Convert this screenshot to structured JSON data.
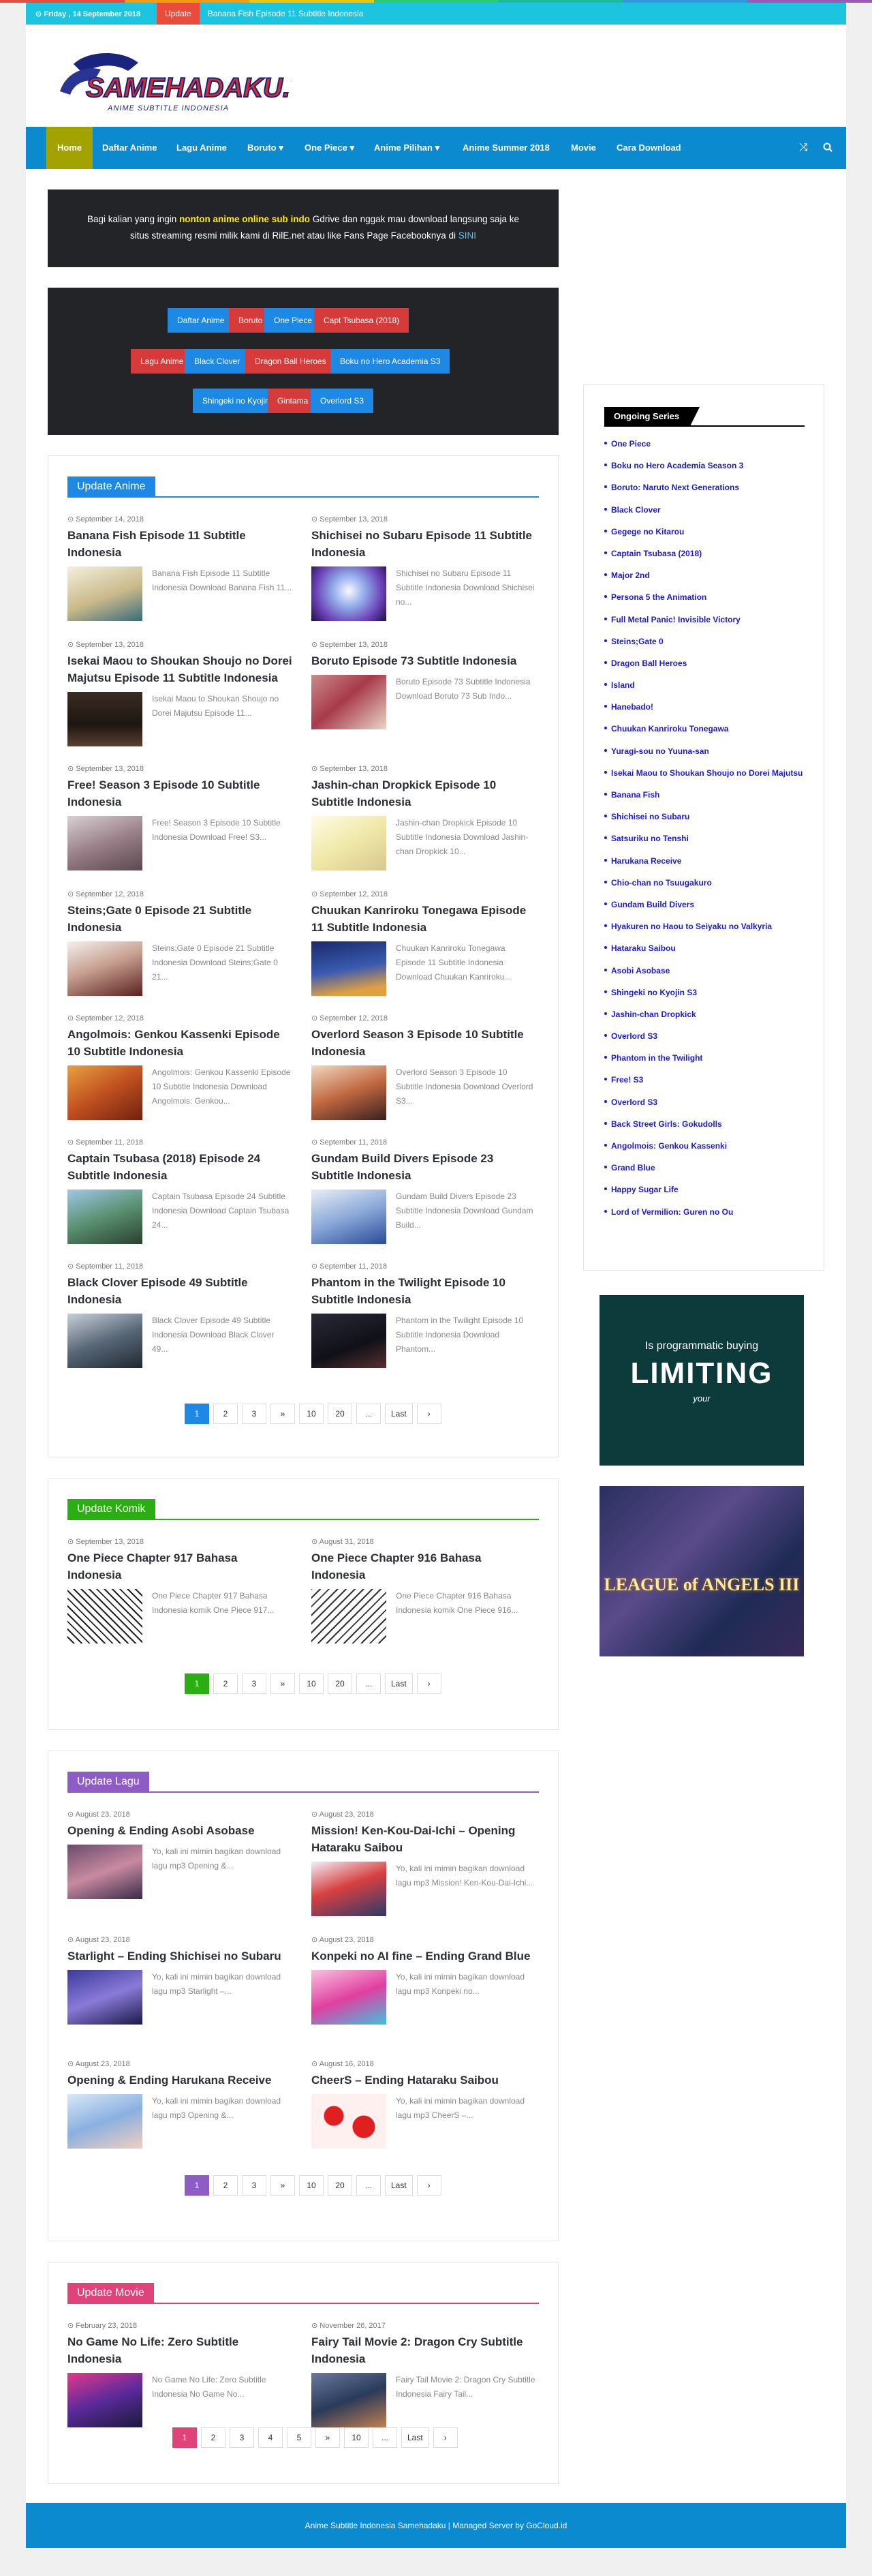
{
  "topbar": {
    "date": "Friday , 14 September 2018",
    "update_label": "Update",
    "ticker": "Banana Fish Episode 11 Subtitle Indonesia"
  },
  "logo": {
    "text": "SAMEHADAKU.TV",
    "sub": "ANIME SUBTITLE INDONESIA"
  },
  "nav": {
    "home": "Home",
    "items": [
      "Daftar Anime",
      "Lagu Anime",
      "Boruto",
      "One Piece",
      "Anime Pilihan",
      "Anime Summer 2018",
      "Movie",
      "Cara Download"
    ]
  },
  "notice": {
    "line1_pre": "Bagi kalian yang ingin ",
    "line1_bold": "nonton anime online sub indo",
    "line1_post": " Gdrive dan nggak mau download langsung saja ke",
    "line2_pre": "situs streaming resmi milik kami di RilE.net atau like Fans Page Facebooknya di ",
    "line2_link": "SINI"
  },
  "tags": [
    "Daftar Anime",
    "Boruto",
    "One Piece",
    "Capt Tsubasa (2018)",
    "Lagu Anime",
    "Black Clover",
    "Dragon Ball Heroes",
    "Boku no Hero Academia S3",
    "Shingeki no Kyojin S3",
    "Gintama",
    "Overlord S3"
  ],
  "update_anime": {
    "title": "Update Anime",
    "posts": [
      {
        "date": "September 14, 2018",
        "title": "Banana Fish Episode 11 Subtitle Indonesia",
        "excerpt": "Banana Fish Episode 11 Subtitle Indonesia Download Banana Fish 11..."
      },
      {
        "date": "September 13, 2018",
        "title": "Shichisei no Subaru Episode 11 Subtitle Indonesia",
        "excerpt": "Shichisei no Subaru Episode 11 Subtitle Indonesia Download Shichisei no..."
      },
      {
        "date": "September 13, 2018",
        "title": "Isekai Maou to Shoukan Shoujo no Dorei Majutsu Episode 11 Subtitle Indonesia",
        "excerpt": "Isekai Maou to Shoukan Shoujo no Dorei Majutsu Episode 11..."
      },
      {
        "date": "September 13, 2018",
        "title": "Boruto Episode 73 Subtitle Indonesia",
        "excerpt": "Boruto Episode 73 Subtitle Indonesia Download Boruto 73 Sub Indo..."
      },
      {
        "date": "September 13, 2018",
        "title": "Free! Season 3 Episode 10 Subtitle Indonesia",
        "excerpt": "Free! Season 3 Episode 10 Subtitle Indonesia Download Free! S3..."
      },
      {
        "date": "September 13, 2018",
        "title": "Jashin-chan Dropkick Episode 10 Subtitle Indonesia",
        "excerpt": "Jashin-chan Dropkick Episode 10 Subtitle Indonesia Download Jashin-chan Dropkick 10..."
      },
      {
        "date": "September 12, 2018",
        "title": "Steins;Gate 0 Episode 21 Subtitle Indonesia",
        "excerpt": "Steins;Gate 0 Episode 21 Subtitle Indonesia Download Steins;Gate 0 21..."
      },
      {
        "date": "September 12, 2018",
        "title": "Chuukan Kanriroku Tonegawa Episode 11 Subtitle Indonesia",
        "excerpt": "Chuukan Kanriroku Tonegawa Episode 11 Subtitle Indonesia Download Chuukan Kanriroku..."
      },
      {
        "date": "September 12, 2018",
        "title": "Angolmois: Genkou Kassenki Episode 10 Subtitle Indonesia",
        "excerpt": "Angolmois: Genkou Kassenki Episode 10 Subtitle Indonesia Download Angolmois: Genkou..."
      },
      {
        "date": "September 12, 2018",
        "title": "Overlord Season 3 Episode 10 Subtitle Indonesia",
        "excerpt": "Overlord Season 3 Episode 10 Subtitle Indonesia Download Overlord S3..."
      },
      {
        "date": "September 11, 2018",
        "title": "Captain Tsubasa (2018) Episode 24 Subtitle Indonesia",
        "excerpt": "Captain Tsubasa Episode 24 Subtitle Indonesia Download Captain Tsubasa 24..."
      },
      {
        "date": "September 11, 2018",
        "title": "Gundam Build Divers Episode 23 Subtitle Indonesia",
        "excerpt": "Gundam Build Divers Episode 23 Subtitle Indonesia Download Gundam Build..."
      },
      {
        "date": "September 11, 2018",
        "title": "Black Clover Episode 49 Subtitle Indonesia",
        "excerpt": "Black Clover Episode 49 Subtitle Indonesia Download Black Clover 49..."
      },
      {
        "date": "September 11, 2018",
        "title": "Phantom in the Twilight Episode 10 Subtitle Indonesia",
        "excerpt": "Phantom in the Twilight Episode 10 Subtitle Indonesia Download Phantom..."
      }
    ],
    "pager": [
      "1",
      "2",
      "3",
      "»",
      "10",
      "20",
      "...",
      "Last",
      "›"
    ]
  },
  "update_komik": {
    "title": "Update Komik",
    "posts": [
      {
        "date": "September 13, 2018",
        "title": "One Piece Chapter 917 Bahasa Indonesia",
        "excerpt": "One Piece Chapter 917 Bahasa Indonesia komik One Piece 917..."
      },
      {
        "date": "August 31, 2018",
        "title": "One Piece Chapter 916 Bahasa Indonesia",
        "excerpt": "One Piece Chapter 916 Bahasa Indonesia komik One Piece 916..."
      }
    ],
    "pager": [
      "1",
      "2",
      "3",
      "»",
      "10",
      "20",
      "...",
      "Last",
      "›"
    ]
  },
  "update_lagu": {
    "title": "Update Lagu",
    "posts": [
      {
        "date": "August 23, 2018",
        "title": "Opening & Ending Asobi Asobase",
        "excerpt": "Yo, kali ini mimin bagikan download lagu mp3 Opening &..."
      },
      {
        "date": "August 23, 2018",
        "title": "Mission! Ken-Kou-Dai-Ichi – Opening Hataraku Saibou",
        "excerpt": "Yo, kali ini mimin bagikan download lagu mp3 Mission! Ken-Kou-Dai-Ichi..."
      },
      {
        "date": "August 23, 2018",
        "title": "Starlight – Ending Shichisei no Subaru",
        "excerpt": "Yo, kali ini mimin bagikan download lagu mp3 Starlight –..."
      },
      {
        "date": "August 23, 2018",
        "title": "Konpeki no AI fine – Ending Grand Blue",
        "excerpt": "Yo, kali ini mimin bagikan download lagu mp3 Konpeki no..."
      },
      {
        "date": "August 23, 2018",
        "title": "Opening & Ending Harukana Receive",
        "excerpt": "Yo, kali ini mimin bagikan download lagu mp3 Opening &..."
      },
      {
        "date": "August 16, 2018",
        "title": "CheerS – Ending Hataraku Saibou",
        "excerpt": "Yo, kali ini mimin bagikan download lagu mp3 CheerS –..."
      }
    ],
    "pager": [
      "1",
      "2",
      "3",
      "»",
      "10",
      "20",
      "...",
      "Last",
      "›"
    ]
  },
  "update_movie": {
    "title": "Update Movie",
    "posts": [
      {
        "date": "February 23, 2018",
        "title": "No Game No Life: Zero Subtitle Indonesia",
        "excerpt": "No Game No Life: Zero Subtitle Indonesia No Game No..."
      },
      {
        "date": "November 26, 2017",
        "title": "Fairy Tail Movie 2: Dragon Cry Subtitle Indonesia",
        "excerpt": "Fairy Tail Movie 2: Dragon Cry Subtitle Indonesia Fairy Tail..."
      }
    ],
    "pager": [
      "1",
      "2",
      "3",
      "4",
      "5",
      "»",
      "10",
      "...",
      "Last",
      "›"
    ]
  },
  "sidebar": {
    "title": "Ongoing Series",
    "items": [
      "One Piece",
      "Boku no Hero Academia Season 3",
      "Boruto: Naruto Next Generations",
      "Black Clover",
      "Gegege no Kitarou",
      "Captain Tsubasa (2018)",
      "Major 2nd",
      "Persona 5 the Animation",
      "Full Metal Panic! Invisible Victory",
      "Steins;Gate 0",
      "Dragon Ball Heroes",
      "Island",
      "Hanebado!",
      "Chuukan Kanriroku Tonegawa",
      "Yuragi-sou no Yuuna-san",
      "Isekai Maou to Shoukan Shoujo no Dorei Majutsu",
      "Banana Fish",
      "Shichisei no Subaru",
      "Satsuriku no Tenshi",
      "Harukana Receive",
      "Chio-chan no Tsuugakuro",
      "Gundam Build Divers",
      "Hyakuren no Haou to Seiyaku no Valkyria",
      "Hataraku Saibou",
      "Asobi Asobase",
      "Shingeki no Kyojin S3",
      "Jashin-chan Dropkick",
      "Overlord S3",
      "Phantom in the Twilight",
      "Free! S3",
      "Overlord S3",
      "Back Street Girls: Gokudolls",
      "Angolmois: Genkou Kassenki",
      "Grand Blue",
      "Happy Sugar Life",
      "Lord of Vermilion: Guren no Ou"
    ]
  },
  "ads": {
    "ad1_small": "Is programmatic buying",
    "ad1_big": "LIMITING",
    "ad1_foot": "your",
    "ad2_text": "LEAGUE of ANGELS III"
  },
  "footer": {
    "text": "Anime Subtitle Indonesia Samehadaku | Managed Server by GoCloud.id"
  },
  "colors": {
    "accent_blue": "#0b8ad0",
    "anime": "#1e88e5",
    "komik": "#2aae12",
    "lagu": "#8d5cc4",
    "movie": "#e0427a"
  }
}
